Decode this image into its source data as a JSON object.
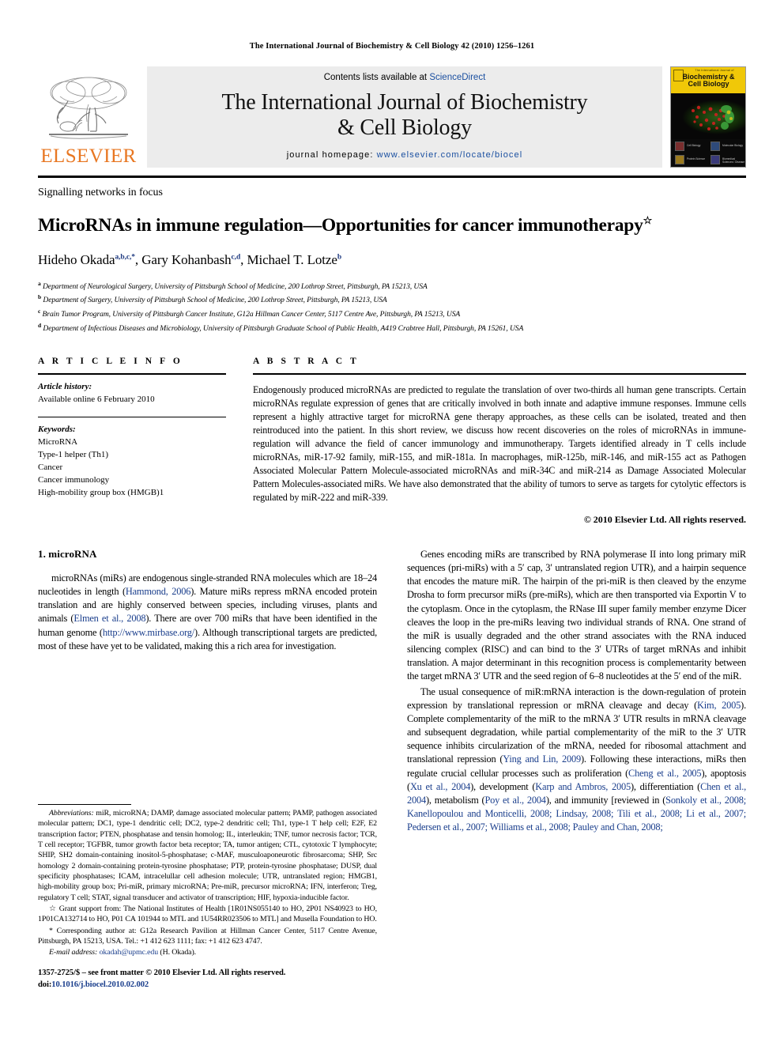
{
  "running_head": "The International Journal of Biochemistry & Cell Biology 42 (2010) 1256–1261",
  "masthead": {
    "publisher": "ELSEVIER",
    "contents_prefix": "Contents lists available at ",
    "contents_link": "ScienceDirect",
    "journal_title_line1": "The International Journal of Biochemistry",
    "journal_title_line2": "& Cell Biology",
    "homepage_prefix": "journal homepage:",
    "homepage_url": "www.elsevier.com/locate/biocel",
    "cover": {
      "kicker": "The International Journal of",
      "title_line1": "Biochemistry &",
      "title_line2": "Cell Biology",
      "icon_labels": [
        "Cell Biology",
        "Molecular Biology",
        "Protein Science",
        "Biomedical Sciences / Disease"
      ]
    }
  },
  "article": {
    "section_kicker": "Signalling networks in focus",
    "title": "MicroRNAs in immune regulation—Opportunities for cancer immunotherapy",
    "title_marker": "☆",
    "authors": [
      {
        "name": "Hideho Okada",
        "sup": "a,b,c,*",
        "sep": ", "
      },
      {
        "name": "Gary Kohanbash",
        "sup": "c,d",
        "sep": ", "
      },
      {
        "name": "Michael T. Lotze",
        "sup": "b",
        "sep": ""
      }
    ],
    "affiliations": [
      {
        "marker": "a",
        "text": "Department of Neurological Surgery, University of Pittsburgh School of Medicine, 200 Lothrop Street, Pittsburgh, PA 15213, USA"
      },
      {
        "marker": "b",
        "text": "Department of Surgery, University of Pittsburgh School of Medicine, 200 Lothrop Street, Pittsburgh, PA 15213, USA"
      },
      {
        "marker": "c",
        "text": "Brain Tumor Program, University of Pittsburgh Cancer Institute, G12a Hillman Cancer Center, 5117 Centre Ave, Pittsburgh, PA 15213, USA"
      },
      {
        "marker": "d",
        "text": "Department of Infectious Diseases and Microbiology, University of Pittsburgh Graduate School of Public Health, A419 Crabtree Hall, Pittsburgh, PA 15261, USA"
      }
    ]
  },
  "article_info": {
    "heading": "A R T I C L E   I N F O",
    "history_label": "Article history:",
    "history_value": "Available online 6 February 2010",
    "keywords_label": "Keywords:",
    "keywords": [
      "MicroRNA",
      "Type-1 helper (Th1)",
      "Cancer",
      "Cancer immunology",
      "High-mobility group box (HMGB)1"
    ]
  },
  "abstract": {
    "heading": "A B S T R A C T",
    "text": "Endogenously produced microRNAs are predicted to regulate the translation of over two-thirds all human gene transcripts. Certain microRNAs regulate expression of genes that are critically involved in both innate and adaptive immune responses. Immune cells represent a highly attractive target for microRNA gene therapy approaches, as these cells can be isolated, treated and then reintroduced into the patient. In this short review, we discuss how recent discoveries on the roles of microRNAs in immune-regulation will advance the field of cancer immunology and immunotherapy. Targets identified already in T cells include microRNAs, miR-17-92 family, miR-155, and miR-181a. In macrophages, miR-125b, miR-146, and miR-155 act as Pathogen Associated Molecular Pattern Molecule-associated microRNAs and miR-34C and miR-214 as Damage Associated Molecular Pattern Molecules-associated miRs. We have also demonstrated that the ability of tumors to serve as targets for cytolytic effectors is regulated by miR-222 and miR-339.",
    "copyright": "© 2010 Elsevier Ltd. All rights reserved."
  },
  "body": {
    "section1_heading": "1. microRNA",
    "left_para1_a": "microRNAs (miRs) are endogenous single-stranded RNA molecules which are 18–24 nucleotides in length (",
    "left_para1_ref1": "Hammond, 2006",
    "left_para1_b": "). Mature miRs repress mRNA encoded protein translation and are highly conserved between species, including viruses, plants and animals (",
    "left_para1_ref2": "Elmen et al., 2008",
    "left_para1_c": "). There are over 700 miRs that have been identified in the human genome (",
    "left_para1_ref3": "http://www.mirbase.org/",
    "left_para1_d": "). Although transcriptional targets are predicted, most of these have yet to be validated, making this a rich area for investigation.",
    "right_para1": "Genes encoding miRs are transcribed by RNA polymerase II into long primary miR sequences (pri-miRs) with a 5′ cap, 3′ untranslated region UTR), and a hairpin sequence that encodes the mature miR. The hairpin of the pri-miR is then cleaved by the enzyme Drosha to form precursor miRs (pre-miRs), which are then transported via Exportin V to the cytoplasm. Once in the cytoplasm, the RNase III super family member enzyme Dicer cleaves the loop in the pre-miRs leaving two individual strands of RNA. One strand of the miR is usually degraded and the other strand associates with the RNA induced silencing complex (RISC) and can bind to the 3′ UTRs of target mRNAs and inhibit translation. A major determinant in this recognition process is complementarity between the target mRNA 3′ UTR and the seed region of 6–8 nucleotides at the 5′ end of the miR.",
    "right_para2_a": "The usual consequence of miR:mRNA interaction is the down-regulation of protein expression by translational repression or mRNA cleavage and decay (",
    "right_para2_ref1": "Kim, 2005",
    "right_para2_b": "). Complete complementarity of the miR to the mRNA 3′ UTR results in mRNA cleavage and subsequent degradation, while partial complementarity of the miR to the 3′ UTR sequence inhibits circularization of the mRNA, needed for ribosomal attachment and translational repression (",
    "right_para2_ref2": "Ying and Lin, 2009",
    "right_para2_c": "). Following these interactions, miRs then regulate crucial cellular processes such as proliferation (",
    "right_para2_ref3": "Cheng et al., 2005",
    "right_para2_d": "), apoptosis (",
    "right_para2_ref4": "Xu et al., 2004",
    "right_para2_e": "), development (",
    "right_para2_ref5": "Karp and Ambros, 2005",
    "right_para2_f": "), differentiation (",
    "right_para2_ref6": "Chen et al., 2004",
    "right_para2_g": "), metabolism (",
    "right_para2_ref7": "Poy et al., 2004",
    "right_para2_h": "), and immunity [reviewed in (",
    "right_para2_ref8": "Sonkoly et al., 2008; Kanellopoulou and Monticelli, 2008; Lindsay, 2008; Tili et al., 2008; Li et al., 2007; Pedersen et al., 2007; Williams et al., 2008; Pauley and Chan, 2008;"
  },
  "footnotes": {
    "abbrev_label": "Abbreviations:",
    "abbrev_text": "miR, microRNA; DAMP, damage associated molecular pattern; PAMP, pathogen associated molecular pattern; DC1, type-1 dendritic cell; DC2, type-2 dendritic cell; Th1, type-1 T help cell; E2F, E2 transcription factor; PTEN, phosphatase and tensin homolog; IL, interleukin; TNF, tumor necrosis factor; TCR, T cell receptor; TGFBR, tumor growth factor beta receptor; TA, tumor antigen; CTL, cytotoxic T lymphocyte; SHIP, SH2 domain-containing inositol-5-phosphatase; c-MAF, musculoaponeurotic fibrosarcoma; SHP, Src homology 2 domain-containing protein-tyrosine phosphatase; PTP, protein-tyrosine phosphatase; DUSP, dual specificity phosphatases; ICAM, intracelullar cell adhesion molecule; UTR, untranslated region; HMGB1, high-mobility group box; Pri-miR, primary microRNA; Pre-miR, precursor microRNA; IFN, interferon; Treg, regulatory T cell; STAT, signal transducer and activator of transcription; HIF, hypoxia-inducible factor.",
    "grant_marker": "☆",
    "grant_text": "Grant support from: The National Institutes of Health [1R01NS055140 to HO, 2P01 NS40923 to HO, 1P01CA132714 to HO, P01 CA 101944 to MTL and 1U54RR023506 to MTL] and Musella Foundation to HO.",
    "corr_marker": "*",
    "corr_text": "Corresponding author at: G12a Research Pavilion at Hillman Cancer Center, 5117 Centre Avenue, Pittsburgh, PA 15213, USA. Tel.: +1 412 623 1111; fax: +1 412 623 4747.",
    "email_label": "E-mail address:",
    "email_value": "okadah@upmc.edu",
    "email_suffix": " (H. Okada).",
    "issn_line": "1357-2725/$ – see front matter © 2010 Elsevier Ltd. All rights reserved.",
    "doi_label": "doi:",
    "doi_value": "10.1016/j.biocel.2010.02.002"
  },
  "colors": {
    "link": "#1a3e8c",
    "elsevier_orange": "#E87722",
    "cover_yellow": "#f0c808",
    "band_gray": "#ececec"
  }
}
